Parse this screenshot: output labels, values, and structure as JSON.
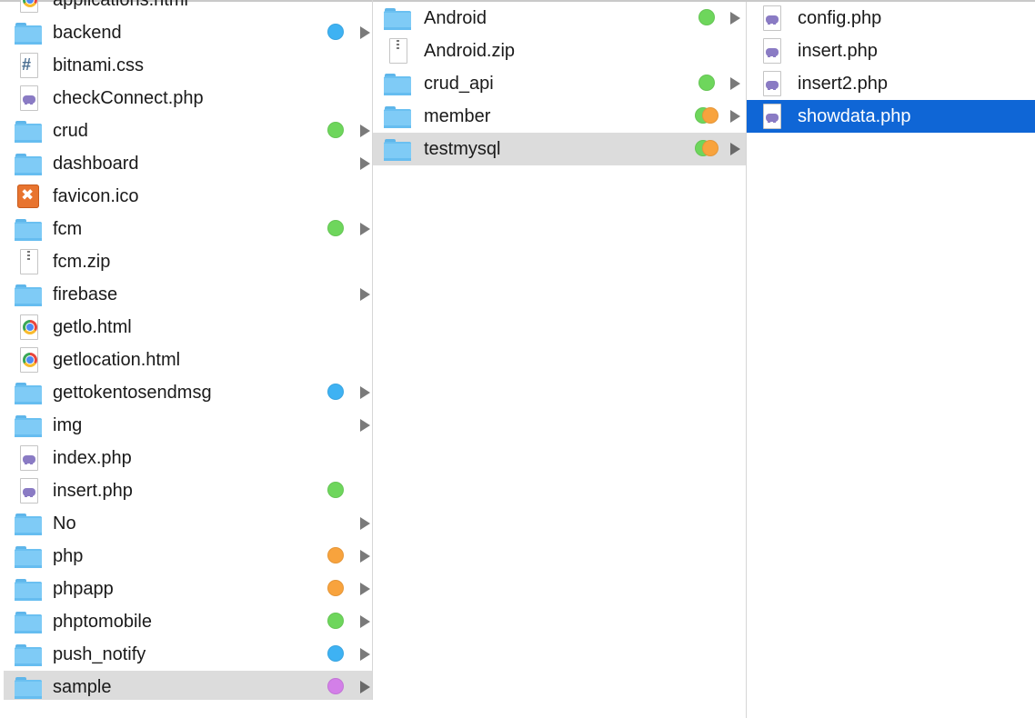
{
  "colors": {
    "green": "#6ed65c",
    "blue": "#3eb2f3",
    "orange": "#f8a33d",
    "purple": "#d37fe8",
    "selection_gray": "#dcdcdc",
    "selection_blue": "#0f66d6"
  },
  "columns": [
    {
      "items": [
        {
          "name": "applications.html",
          "icon": "chrome-html-icon",
          "tags": [],
          "folder": false
        },
        {
          "name": "backend",
          "icon": "folder-icon",
          "tags": [
            "blue"
          ],
          "folder": true
        },
        {
          "name": "bitnami.css",
          "icon": "css-file-icon",
          "tags": [],
          "folder": false
        },
        {
          "name": "checkConnect.php",
          "icon": "php-file-icon",
          "tags": [],
          "folder": false
        },
        {
          "name": "crud",
          "icon": "folder-icon",
          "tags": [
            "green"
          ],
          "folder": true
        },
        {
          "name": "dashboard",
          "icon": "folder-icon",
          "tags": [],
          "folder": true
        },
        {
          "name": "favicon.ico",
          "icon": "xampp-ico-icon",
          "tags": [],
          "folder": false
        },
        {
          "name": "fcm",
          "icon": "folder-icon",
          "tags": [
            "green"
          ],
          "folder": true
        },
        {
          "name": "fcm.zip",
          "icon": "zip-file-icon",
          "tags": [],
          "folder": false
        },
        {
          "name": "firebase",
          "icon": "folder-icon",
          "tags": [],
          "folder": true
        },
        {
          "name": "getlo.html",
          "icon": "chrome-html-icon",
          "tags": [],
          "folder": false
        },
        {
          "name": "getlocation.html",
          "icon": "chrome-html-icon",
          "tags": [],
          "folder": false
        },
        {
          "name": "gettokentosendmsg",
          "icon": "folder-icon",
          "tags": [
            "blue"
          ],
          "folder": true
        },
        {
          "name": "img",
          "icon": "folder-icon",
          "tags": [],
          "folder": true
        },
        {
          "name": "index.php",
          "icon": "php-file-icon",
          "tags": [],
          "folder": false
        },
        {
          "name": "insert.php",
          "icon": "php-file-icon",
          "tags": [
            "green"
          ],
          "folder": false
        },
        {
          "name": "No",
          "icon": "folder-icon",
          "tags": [],
          "folder": true
        },
        {
          "name": "php",
          "icon": "folder-icon",
          "tags": [
            "orange"
          ],
          "folder": true
        },
        {
          "name": "phpapp",
          "icon": "folder-icon",
          "tags": [
            "orange"
          ],
          "folder": true
        },
        {
          "name": "phptomobile",
          "icon": "folder-icon",
          "tags": [
            "green"
          ],
          "folder": true
        },
        {
          "name": "push_notify",
          "icon": "folder-icon",
          "tags": [
            "blue"
          ],
          "folder": true
        },
        {
          "name": "sample",
          "icon": "folder-icon",
          "tags": [
            "purple"
          ],
          "folder": true,
          "selected": "gray"
        }
      ]
    },
    {
      "items": [
        {
          "name": "Android",
          "icon": "folder-icon",
          "tags": [
            "green"
          ],
          "folder": true
        },
        {
          "name": "Android.zip",
          "icon": "zip-file-icon",
          "tags": [],
          "folder": false
        },
        {
          "name": "crud_api",
          "icon": "folder-icon",
          "tags": [
            "green"
          ],
          "folder": true
        },
        {
          "name": "member",
          "icon": "folder-icon",
          "tags": [
            "green",
            "orange"
          ],
          "folder": true
        },
        {
          "name": "testmysql",
          "icon": "folder-icon",
          "tags": [
            "green",
            "orange"
          ],
          "folder": true,
          "selected": "gray"
        }
      ]
    },
    {
      "items": [
        {
          "name": "config.php",
          "icon": "php-file-icon",
          "tags": [],
          "folder": false
        },
        {
          "name": "insert.php",
          "icon": "php-file-icon",
          "tags": [],
          "folder": false
        },
        {
          "name": "insert2.php",
          "icon": "php-file-icon",
          "tags": [],
          "folder": false
        },
        {
          "name": "showdata.php",
          "icon": "php-file-icon",
          "tags": [],
          "folder": false,
          "selected": "blue"
        }
      ]
    }
  ]
}
